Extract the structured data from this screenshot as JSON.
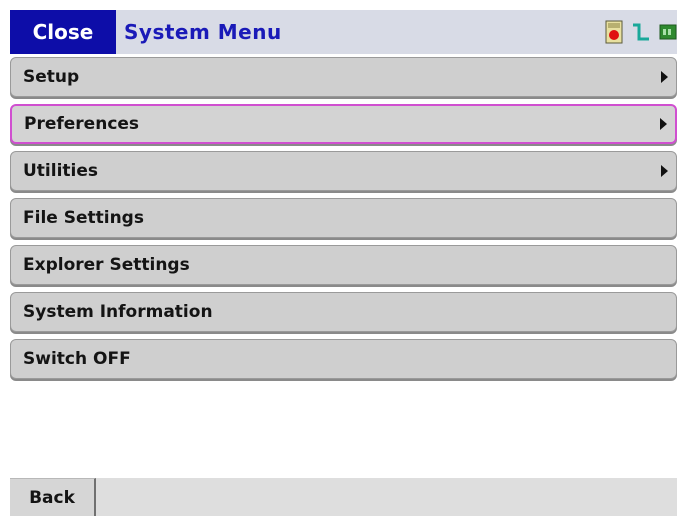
{
  "titlebar": {
    "close_label": "Close",
    "title": "System Menu",
    "icons": [
      "battery-alert-icon",
      "signal-pulse-icon",
      "battery-status-icon"
    ]
  },
  "menu": {
    "items": [
      {
        "label": "Setup",
        "has_submenu": true
      },
      {
        "label": "Preferences",
        "has_submenu": true,
        "selected": true
      },
      {
        "label": "Utilities",
        "has_submenu": true
      },
      {
        "label": "File Settings",
        "has_submenu": false
      },
      {
        "label": "Explorer Settings",
        "has_submenu": false
      },
      {
        "label": "System Information",
        "has_submenu": false
      },
      {
        "label": "Switch OFF",
        "has_submenu": false
      }
    ]
  },
  "bottombar": {
    "back_label": "Back"
  },
  "colors": {
    "close_bg": "#0d0da8",
    "title_text": "#1a1ab8",
    "selected_border": "#d04fd0",
    "menu_item_bg": "#cfcfcf"
  }
}
